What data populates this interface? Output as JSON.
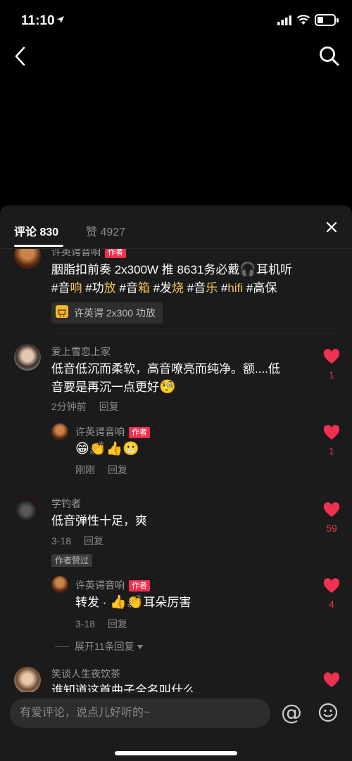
{
  "status_bar": {
    "time": "11:10"
  },
  "sheet": {
    "tabs": [
      {
        "label": "评论 830",
        "active": true
      },
      {
        "label": "赞 4927",
        "active": false
      }
    ]
  },
  "comments": [
    {
      "user": "许英谔音响",
      "is_author": true,
      "author_tag": "作者",
      "text_parts": [
        {
          "t": "胭脂扣前奏 2x300W 推 8631务必戴",
          "hl": false
        },
        {
          "t": "🎧",
          "hl": false
        },
        {
          "t": "耳机听",
          "hl": false
        }
      ],
      "hashtags": [
        "#音",
        "响",
        " #功",
        "放",
        " #音",
        "箱",
        " #发",
        "烧",
        " #音",
        "乐",
        " #",
        "hifi",
        " #高保"
      ],
      "product": "许英谔 2x300 功放"
    },
    {
      "user": "爱上雪恋上家",
      "text_line1": "低音低沉而柔软，高音嘹亮而纯净。额....低",
      "text_line2": "音要是再沉一点更好",
      "text_emoji": "🧐",
      "time": "2分钟前",
      "reply_label": "回复",
      "likes": "1",
      "reply": {
        "user": "许英谔音响",
        "author_tag": "作者",
        "emojis": "😁👏👍😬",
        "time": "刚刚",
        "reply_label": "回复",
        "likes": "1"
      }
    },
    {
      "user": "学钓者",
      "text": "低音弹性十足，爽",
      "time": "3-18",
      "reply_label": "回复",
      "liked_by_author": "作者赞过",
      "likes": "59",
      "reply": {
        "user": "许英谔音响",
        "author_tag": "作者",
        "text_before": "转发 · ",
        "emojis": "👍👏",
        "text_after": "耳朵厉害",
        "time": "3-18",
        "reply_label": "回复",
        "likes": "4"
      },
      "expand": "展开11条回复"
    },
    {
      "user": "笑谈人生夜饮茶",
      "text": "谁知道这首曲子全名叫什么"
    }
  ],
  "composer": {
    "placeholder": "有爱评论，说点儿好听的~",
    "at_label": "@"
  },
  "colors": {
    "accent": "#f0304f",
    "hashtag": "#f5c453",
    "sheet_bg": "#1b1b1b"
  }
}
